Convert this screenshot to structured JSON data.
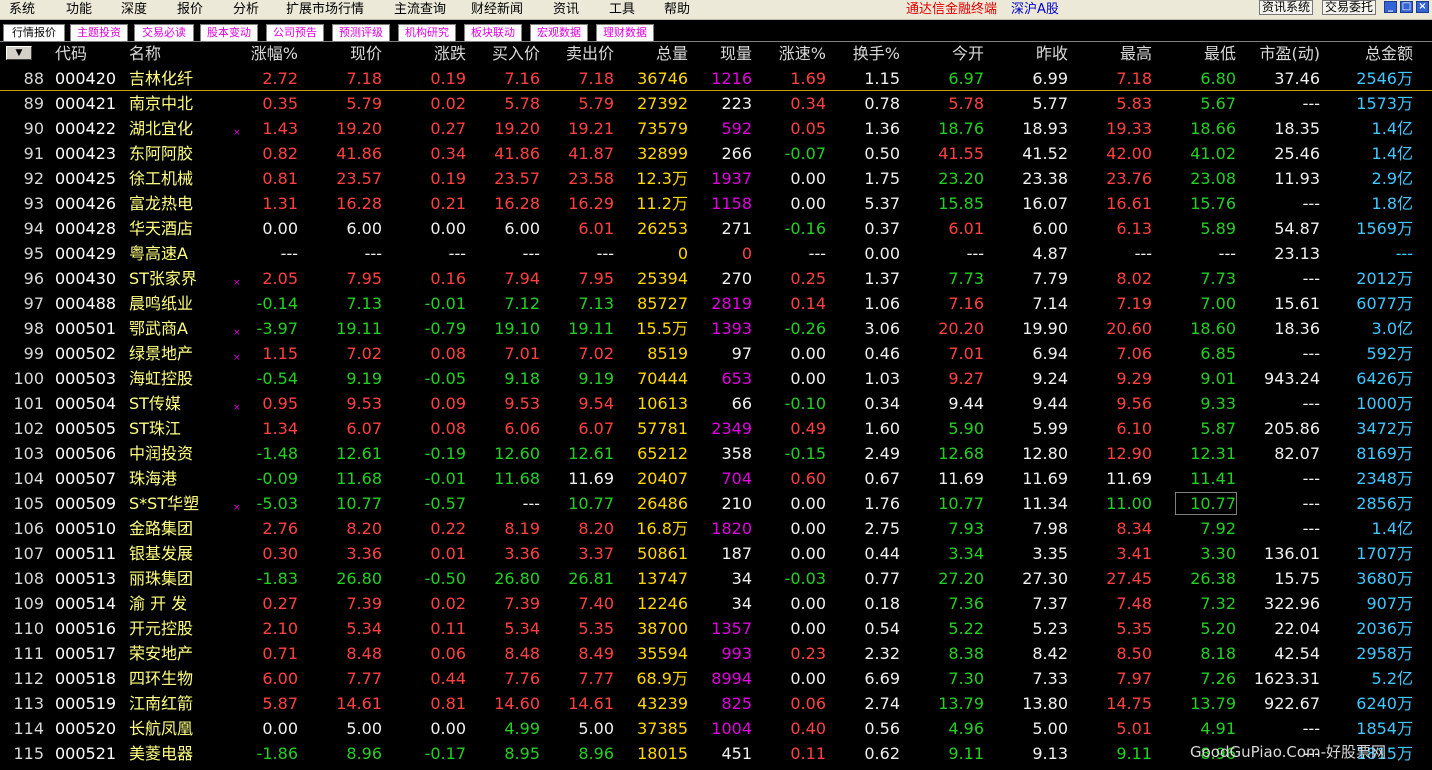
{
  "menu": {
    "items": [
      "系统",
      "功能",
      "深度",
      "报价",
      "分析",
      "扩展市场行情",
      "主流查询",
      "财经新闻",
      "资讯",
      "工具",
      "帮助"
    ],
    "terminal_name": "通达信金融终端",
    "market": "深沪A股",
    "btn_info": "资讯系统",
    "btn_trade": "交易委托"
  },
  "tabs": [
    "行情报价",
    "主题投资",
    "交易必读",
    "股本变动",
    "公司预告",
    "预测评级",
    "机构研究",
    "板块联动",
    "宏观数据",
    "理财数据"
  ],
  "headers": {
    "sort_arrow": "▼",
    "code": "代码",
    "name": "名称",
    "change_pct": "涨幅%",
    "price": "现价",
    "change": "涨跌",
    "bid": "买入价",
    "ask": "卖出价",
    "volume": "总量",
    "cur_vol": "现量",
    "speed": "涨速%",
    "turnover": "换手%",
    "open": "今开",
    "prev_close": "昨收",
    "high": "最高",
    "low": "最低",
    "pe": "市盈(动)",
    "amount": "总金额"
  },
  "rows": [
    [
      "88",
      "000420",
      "吉林化纤",
      false,
      "2.72",
      "7.18",
      "0.19",
      "7.16",
      "7.18",
      "36746",
      "1216",
      "1.69",
      "1.15",
      "6.97",
      "6.99",
      "7.18",
      "6.80",
      "37.46",
      "2546万"
    ],
    [
      "89",
      "000421",
      "南京中北",
      false,
      "0.35",
      "5.79",
      "0.02",
      "5.78",
      "5.79",
      "27392",
      "223",
      "0.34",
      "0.78",
      "5.78",
      "5.77",
      "5.83",
      "5.67",
      "---",
      "1573万"
    ],
    [
      "90",
      "000422",
      "湖北宜化",
      true,
      "1.43",
      "19.20",
      "0.27",
      "19.20",
      "19.21",
      "73579",
      "592",
      "0.05",
      "1.36",
      "18.76",
      "18.93",
      "19.33",
      "18.66",
      "18.35",
      "1.4亿"
    ],
    [
      "91",
      "000423",
      "东阿阿胶",
      false,
      "0.82",
      "41.86",
      "0.34",
      "41.86",
      "41.87",
      "32899",
      "266",
      "-0.07",
      "0.50",
      "41.55",
      "41.52",
      "42.00",
      "41.02",
      "25.46",
      "1.4亿"
    ],
    [
      "92",
      "000425",
      "徐工机械",
      false,
      "0.81",
      "23.57",
      "0.19",
      "23.57",
      "23.58",
      "12.3万",
      "1937",
      "0.00",
      "1.75",
      "23.20",
      "23.38",
      "23.76",
      "23.08",
      "11.93",
      "2.9亿"
    ],
    [
      "93",
      "000426",
      "富龙热电",
      false,
      "1.31",
      "16.28",
      "0.21",
      "16.28",
      "16.29",
      "11.2万",
      "1158",
      "0.00",
      "5.37",
      "15.85",
      "16.07",
      "16.61",
      "15.76",
      "---",
      "1.8亿"
    ],
    [
      "94",
      "000428",
      "华天酒店",
      false,
      "0.00",
      "6.00",
      "0.00",
      "6.00",
      "6.01",
      "26253",
      "271",
      "-0.16",
      "0.37",
      "6.01",
      "6.00",
      "6.13",
      "5.89",
      "54.87",
      "1569万"
    ],
    [
      "95",
      "000429",
      "粤高速A",
      false,
      "---",
      "---",
      "---",
      "---",
      "---",
      "0",
      "0",
      "---",
      "0.00",
      "---",
      "4.87",
      "---",
      "---",
      "23.13",
      "---"
    ],
    [
      "96",
      "000430",
      "ST张家界",
      true,
      "2.05",
      "7.95",
      "0.16",
      "7.94",
      "7.95",
      "25394",
      "270",
      "0.25",
      "1.37",
      "7.73",
      "7.79",
      "8.02",
      "7.73",
      "---",
      "2012万"
    ],
    [
      "97",
      "000488",
      "晨鸣纸业",
      false,
      "-0.14",
      "7.13",
      "-0.01",
      "7.12",
      "7.13",
      "85727",
      "2819",
      "0.14",
      "1.06",
      "7.16",
      "7.14",
      "7.19",
      "7.00",
      "15.61",
      "6077万"
    ],
    [
      "98",
      "000501",
      "鄂武商A",
      true,
      "-3.97",
      "19.11",
      "-0.79",
      "19.10",
      "19.11",
      "15.5万",
      "1393",
      "-0.26",
      "3.06",
      "20.20",
      "19.90",
      "20.60",
      "18.60",
      "18.36",
      "3.0亿"
    ],
    [
      "99",
      "000502",
      "绿景地产",
      true,
      "1.15",
      "7.02",
      "0.08",
      "7.01",
      "7.02",
      "8519",
      "97",
      "0.00",
      "0.46",
      "7.01",
      "6.94",
      "7.06",
      "6.85",
      "---",
      "592万"
    ],
    [
      "100",
      "000503",
      "海虹控股",
      false,
      "-0.54",
      "9.19",
      "-0.05",
      "9.18",
      "9.19",
      "70444",
      "653",
      "0.00",
      "1.03",
      "9.27",
      "9.24",
      "9.29",
      "9.01",
      "943.24",
      "6426万"
    ],
    [
      "101",
      "000504",
      "ST传媒",
      true,
      "0.95",
      "9.53",
      "0.09",
      "9.53",
      "9.54",
      "10613",
      "66",
      "-0.10",
      "0.34",
      "9.44",
      "9.44",
      "9.56",
      "9.33",
      "---",
      "1000万"
    ],
    [
      "102",
      "000505",
      "ST珠江",
      false,
      "1.34",
      "6.07",
      "0.08",
      "6.06",
      "6.07",
      "57781",
      "2349",
      "0.49",
      "1.60",
      "5.90",
      "5.99",
      "6.10",
      "5.87",
      "205.86",
      "3472万"
    ],
    [
      "103",
      "000506",
      "中润投资",
      false,
      "-1.48",
      "12.61",
      "-0.19",
      "12.60",
      "12.61",
      "65212",
      "358",
      "-0.15",
      "2.49",
      "12.68",
      "12.80",
      "12.90",
      "12.31",
      "82.07",
      "8169万"
    ],
    [
      "104",
      "000507",
      "珠海港",
      false,
      "-0.09",
      "11.68",
      "-0.01",
      "11.68",
      "11.69",
      "20407",
      "704",
      "0.60",
      "0.67",
      "11.69",
      "11.69",
      "11.69",
      "11.41",
      "---",
      "2348万"
    ],
    [
      "105",
      "000509",
      "S*ST华塑",
      true,
      "-5.03",
      "10.77",
      "-0.57",
      "---",
      "10.77",
      "26486",
      "210",
      "0.00",
      "1.76",
      "10.77",
      "11.34",
      "11.00",
      "10.77",
      "---",
      "2856万"
    ],
    [
      "106",
      "000510",
      "金路集团",
      false,
      "2.76",
      "8.20",
      "0.22",
      "8.19",
      "8.20",
      "16.8万",
      "1820",
      "0.00",
      "2.75",
      "7.93",
      "7.98",
      "8.34",
      "7.92",
      "---",
      "1.4亿"
    ],
    [
      "107",
      "000511",
      "银基发展",
      false,
      "0.30",
      "3.36",
      "0.01",
      "3.36",
      "3.37",
      "50861",
      "187",
      "0.00",
      "0.44",
      "3.34",
      "3.35",
      "3.41",
      "3.30",
      "136.01",
      "1707万"
    ],
    [
      "108",
      "000513",
      "丽珠集团",
      false,
      "-1.83",
      "26.80",
      "-0.50",
      "26.80",
      "26.81",
      "13747",
      "34",
      "-0.03",
      "0.77",
      "27.20",
      "27.30",
      "27.45",
      "26.38",
      "15.75",
      "3680万"
    ],
    [
      "109",
      "000514",
      "渝 开 发",
      false,
      "0.27",
      "7.39",
      "0.02",
      "7.39",
      "7.40",
      "12246",
      "34",
      "0.00",
      "0.18",
      "7.36",
      "7.37",
      "7.48",
      "7.32",
      "322.96",
      "907万"
    ],
    [
      "110",
      "000516",
      "开元控股",
      false,
      "2.10",
      "5.34",
      "0.11",
      "5.34",
      "5.35",
      "38700",
      "1357",
      "0.00",
      "0.54",
      "5.22",
      "5.23",
      "5.35",
      "5.20",
      "22.04",
      "2036万"
    ],
    [
      "111",
      "000517",
      "荣安地产",
      false,
      "0.71",
      "8.48",
      "0.06",
      "8.48",
      "8.49",
      "35594",
      "993",
      "0.23",
      "2.32",
      "8.38",
      "8.42",
      "8.50",
      "8.18",
      "42.54",
      "2958万"
    ],
    [
      "112",
      "000518",
      "四环生物",
      false,
      "6.00",
      "7.77",
      "0.44",
      "7.76",
      "7.77",
      "68.9万",
      "8994",
      "0.00",
      "6.69",
      "7.30",
      "7.33",
      "7.97",
      "7.26",
      "1623.31",
      "5.2亿"
    ],
    [
      "113",
      "000519",
      "江南红箭",
      false,
      "5.87",
      "14.61",
      "0.81",
      "14.60",
      "14.61",
      "43239",
      "825",
      "0.06",
      "2.74",
      "13.79",
      "13.80",
      "14.75",
      "13.79",
      "922.67",
      "6240万"
    ],
    [
      "114",
      "000520",
      "长航凤凰",
      false,
      "0.00",
      "5.00",
      "0.00",
      "4.99",
      "5.00",
      "37385",
      "1004",
      "0.40",
      "0.56",
      "4.96",
      "5.00",
      "5.01",
      "4.91",
      "---",
      "1854万"
    ],
    [
      "115",
      "000521",
      "美菱电器",
      false,
      "-1.86",
      "8.96",
      "-0.17",
      "8.95",
      "8.96",
      "18015",
      "451",
      "0.11",
      "0.62",
      "9.11",
      "9.13",
      "9.11",
      "8.96",
      "---",
      "1815万"
    ]
  ],
  "watermark": "GoodGuPiao.Com-好股票网",
  "colors": {
    "up": "#ff4040",
    "down": "#22d022",
    "flat": "#f0f0f0",
    "vol": "#ffd700",
    "name": "#ffff80",
    "code": "#ffffff",
    "amount": "#40c8ff",
    "curvol_up": "#e000e0",
    "header": "#d8d8d8"
  }
}
